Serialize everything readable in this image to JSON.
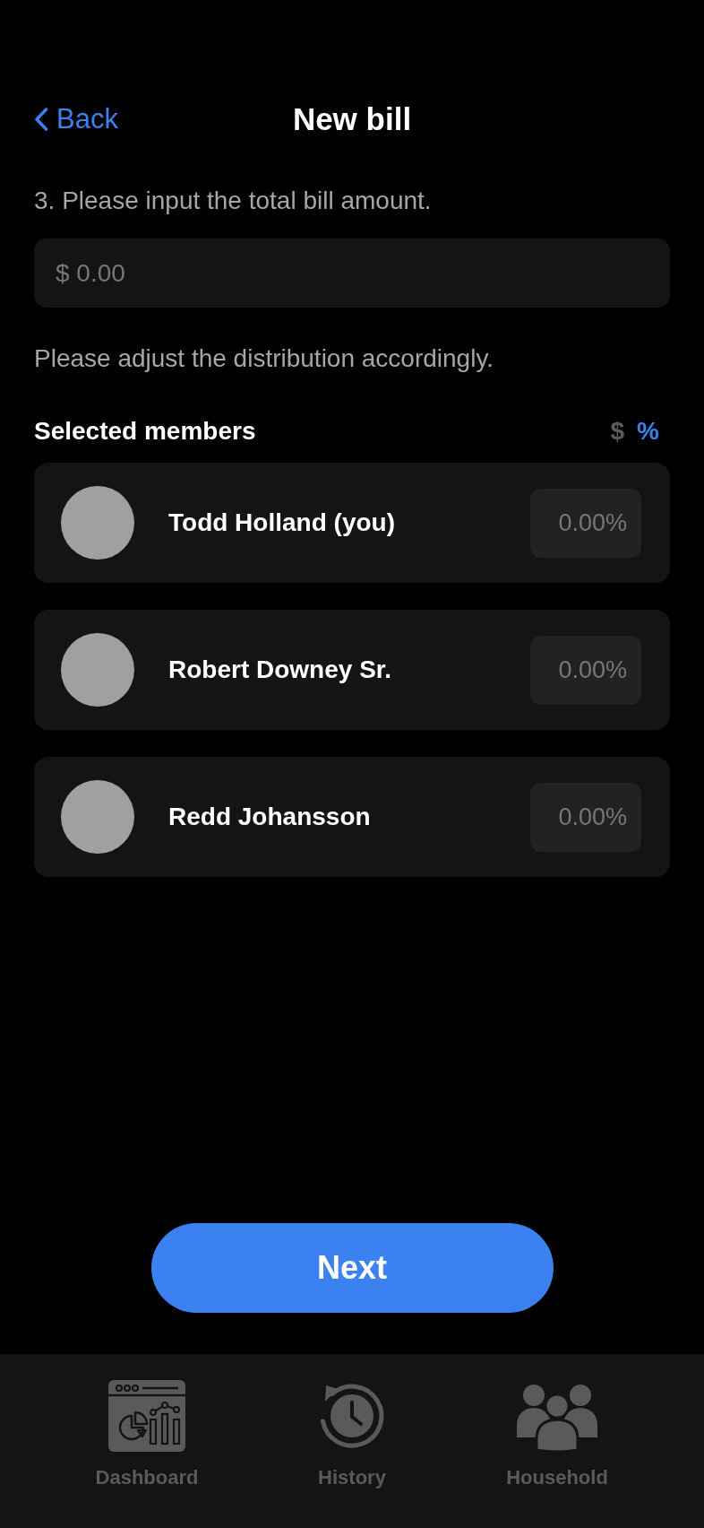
{
  "header": {
    "back": "Back",
    "title": "New bill"
  },
  "prompt": "3. Please input the total bill amount.",
  "amount_field": {
    "placeholder": "$ 0.00"
  },
  "instruction": "Please adjust the distribution accordingly.",
  "members_section": {
    "title": "Selected members",
    "units": [
      {
        "label": "$",
        "selected": false
      },
      {
        "label": "%",
        "selected": true
      }
    ]
  },
  "members": [
    {
      "name": "Todd Holland (you)",
      "share_field": {
        "placeholder": "0.00%"
      }
    },
    {
      "name": "Robert Downey Sr.",
      "share_field": {
        "placeholder": "0.00%"
      }
    },
    {
      "name": "Redd Johansson",
      "share_field": {
        "placeholder": "0.00%"
      }
    }
  ],
  "next_button": "Next",
  "tab_bar": [
    {
      "label": "Dashboard",
      "kind": "dashboard",
      "selected": false
    },
    {
      "label": "History",
      "kind": "history",
      "selected": false
    },
    {
      "label": "Household",
      "kind": "household",
      "selected": false
    }
  ]
}
